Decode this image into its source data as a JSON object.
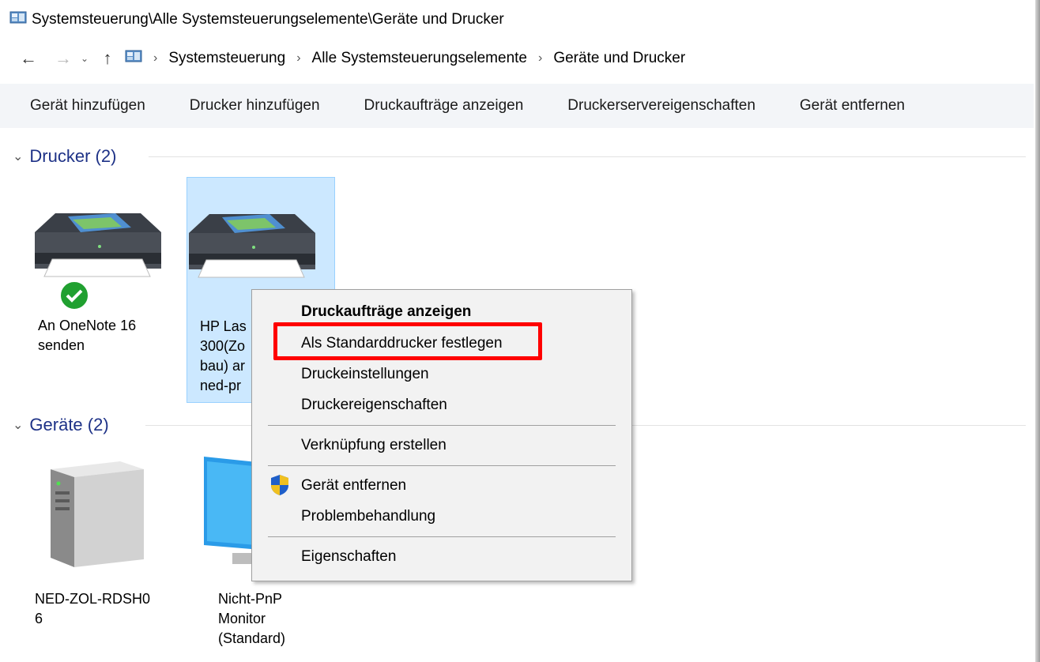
{
  "window": {
    "title": "Systemsteuerung\\Alle Systemsteuerungselemente\\Geräte und Drucker"
  },
  "nav": {
    "back_icon": "←",
    "forward_icon": "→",
    "recent_icon": "⌄",
    "up_icon": "↑"
  },
  "breadcrumb": [
    "Systemsteuerung",
    "Alle Systemsteuerungselemente",
    "Geräte und Drucker"
  ],
  "breadcrumb_separator": "›",
  "toolbar": {
    "items": [
      "Gerät hinzufügen",
      "Drucker hinzufügen",
      "Druckaufträge anzeigen",
      "Druckerservereigenschaften",
      "Gerät entfernen"
    ]
  },
  "groups": {
    "printers": {
      "chevron": "⌄",
      "label": "Drucker (2)"
    },
    "devices": {
      "chevron": "⌄",
      "label": "Geräte (2)"
    }
  },
  "printers": [
    {
      "label": "An OneNote 16\nsenden",
      "default": true
    },
    {
      "label": "HP Las\n300(Zo\nbau) ar\nned-pr",
      "selected": true
    }
  ],
  "devices": [
    {
      "label": "NED-ZOL-RDSH0\n6"
    },
    {
      "label": "Nicht-PnP\nMonitor\n(Standard)"
    }
  ],
  "context_menu": {
    "items": [
      {
        "label": "Druckaufträge anzeigen",
        "bold": true
      },
      {
        "label": "Als Standarddrucker festlegen",
        "highlighted": true
      },
      {
        "label": "Druckeinstellungen"
      },
      {
        "label": "Druckereigenschaften"
      },
      {
        "label": "Verknüpfung erstellen"
      },
      {
        "label": "Gerät entfernen",
        "icon": "uac-shield-icon"
      },
      {
        "label": "Problembehandlung"
      },
      {
        "label": "Eigenschaften"
      }
    ]
  },
  "colors": {
    "group_header": "#1e3287",
    "selection_bg": "#cce8ff",
    "highlight_box": "#ff0000",
    "default_check": "#20a030"
  }
}
